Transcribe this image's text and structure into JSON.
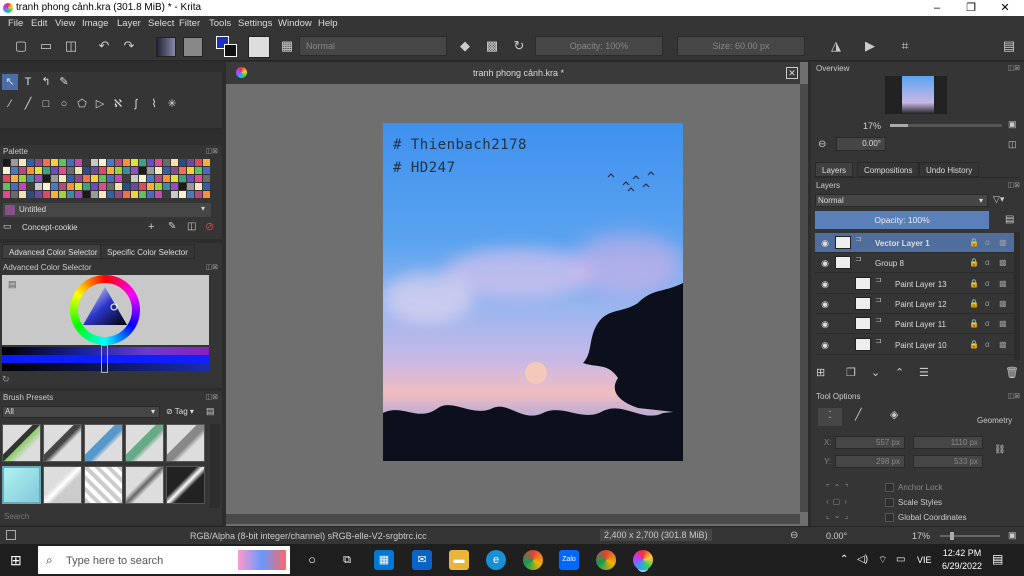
{
  "window": {
    "title": "tranh phong cảnh.kra (301.8 MiB)  * - Krita",
    "minimize": "–",
    "maximize": "❐",
    "close": "✕"
  },
  "menu": [
    "File",
    "Edit",
    "View",
    "Image",
    "Layer",
    "Select",
    "Filter",
    "Tools",
    "Settings",
    "Window",
    "Help"
  ],
  "toolbar": {
    "blend_mode": "Normal",
    "opacity": "Opacity: 100%",
    "size": "Size: 60.00 px"
  },
  "dockers": {
    "palette_title": "Palette",
    "palette_name": "Untitled",
    "palette_resource": "Concept-cookie",
    "color_tabs": [
      "Advanced Color Selector",
      "Specific Color Selector"
    ],
    "color_selector_title": "Advanced Color Selector",
    "brush_presets_title": "Brush Presets",
    "brush_filter": "All",
    "brush_tag": "Tag",
    "brush_search": "Search"
  },
  "document": {
    "tab_title": "tranh phong cảnh.kra *",
    "painting_text_line1": "# Thienbach2178",
    "painting_text_line2": "# HD247"
  },
  "overview": {
    "title": "Overview",
    "zoom": "17%",
    "rotation": "0.00°"
  },
  "layers_panel": {
    "tabs": [
      "Layers",
      "Compositions",
      "Undo History"
    ],
    "title": "Layers",
    "blend_mode": "Normal",
    "opacity": "Opacity:  100%",
    "layers": [
      {
        "name": "Vector Layer 1",
        "selected": true,
        "indent": 0
      },
      {
        "name": "Group 8",
        "selected": false,
        "indent": 0
      },
      {
        "name": "Paint Layer 13",
        "selected": false,
        "indent": 1
      },
      {
        "name": "Paint Layer 12",
        "selected": false,
        "indent": 1
      },
      {
        "name": "Paint Layer 11",
        "selected": false,
        "indent": 1
      },
      {
        "name": "Paint Layer 10",
        "selected": false,
        "indent": 1
      }
    ]
  },
  "tool_options": {
    "title": "Tool Options",
    "geometry": "Geometry",
    "x_label": "X:",
    "x_value": "557 px",
    "y_label": "Y:",
    "y_value": "298 px",
    "w_value": "1110 px",
    "h_value": "533 px",
    "anchor_lock": "Anchor Lock",
    "scale_styles": "Scale Styles",
    "global_coords": "Global Coordinates"
  },
  "status": {
    "color_space": "RGB/Alpha (8-bit integer/channel)  sRGB-elle-V2-srgbtrc.icc",
    "dimensions": "2,400 x 2,700 (301.8 MiB)",
    "rotation": "0.00°",
    "zoom": "17%"
  },
  "taskbar": {
    "search_placeholder": "Type here to search",
    "time": "12:42 PM",
    "date": "6/29/2022",
    "lang": "VIE",
    "zalo": "Zalo"
  }
}
